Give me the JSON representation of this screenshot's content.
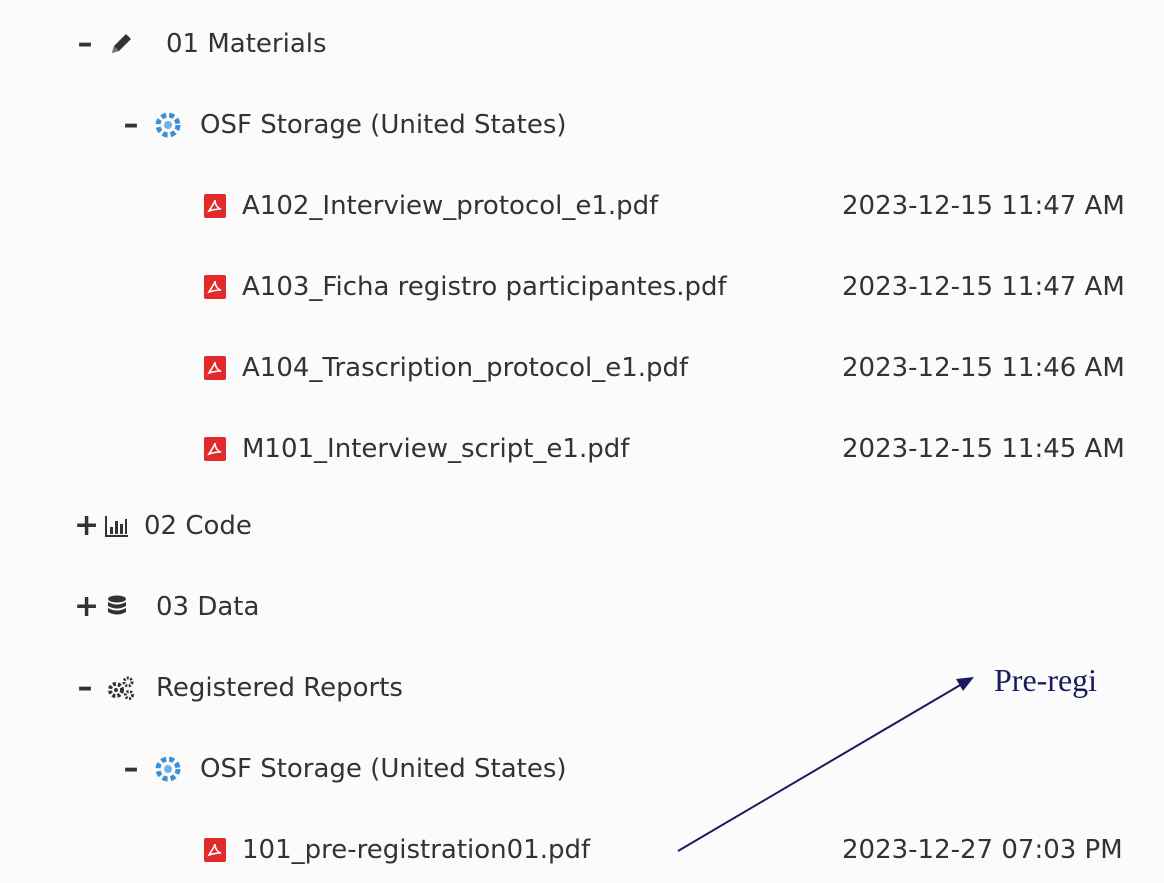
{
  "tree": {
    "materials": {
      "toggle": "–",
      "icon": "pencil-icon",
      "label": "01 Materials"
    },
    "materials_storage": {
      "toggle": "–",
      "icon": "osf-storage-icon",
      "label": "OSF Storage (United States)"
    },
    "materials_files": [
      {
        "name": "A102_Interview_protocol_e1.pdf",
        "modified": "2023-12-15 11:47 AM"
      },
      {
        "name": "A103_Ficha registro participantes.pdf",
        "modified": "2023-12-15 11:47 AM"
      },
      {
        "name": "A104_Trascription_protocol_e1.pdf",
        "modified": "2023-12-15 11:46 AM"
      },
      {
        "name": "M101_Interview_script_e1.pdf",
        "modified": "2023-12-15 11:45 AM"
      }
    ],
    "code": {
      "toggle": "+",
      "icon": "bar-chart-icon",
      "label": "02 Code"
    },
    "data": {
      "toggle": "+",
      "icon": "database-icon",
      "label": "03 Data"
    },
    "registered_reports": {
      "toggle": "–",
      "icon": "gears-icon",
      "label": "Registered Reports"
    },
    "rr_storage": {
      "toggle": "–",
      "icon": "osf-storage-icon",
      "label": "OSF Storage (United States)"
    },
    "rr_files": [
      {
        "name": "101_pre-registration01.pdf",
        "modified": "2023-12-27 07:03 PM"
      }
    ]
  },
  "annotation": {
    "text": "Pre-regi",
    "color": "#1a1a5e"
  },
  "colors": {
    "pdf_red": "#e22a2a",
    "text": "#333333",
    "storage_blue": "#3a8fd6"
  }
}
